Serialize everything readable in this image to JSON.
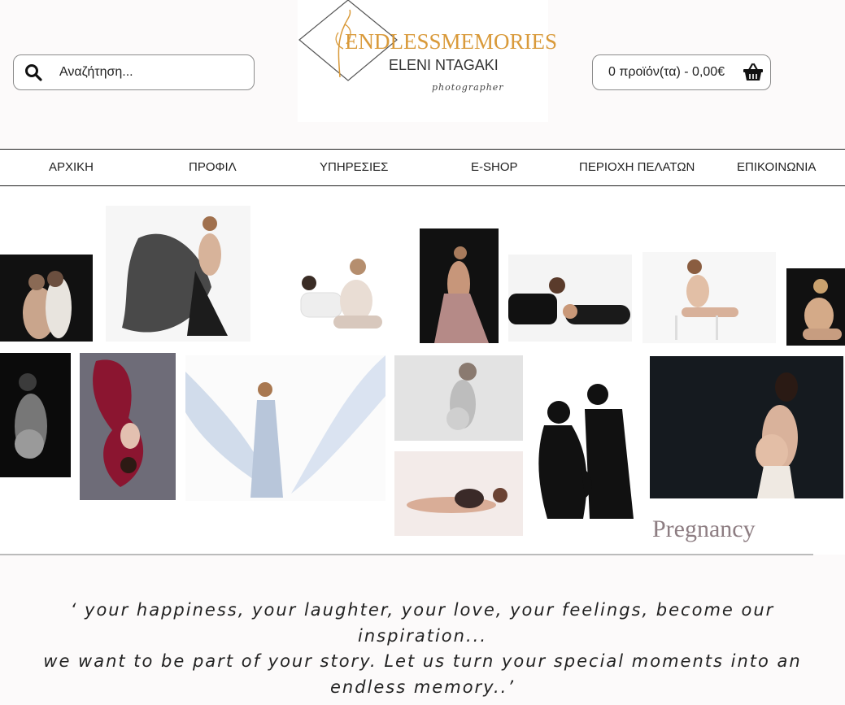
{
  "search": {
    "placeholder": "Αναζήτηση..."
  },
  "logo": {
    "line1": "ENDLESSMEMORIES",
    "line2": "ELENI NTAGAKI",
    "line3": "photographer"
  },
  "cart": {
    "summary": "0 προϊόν(τα) - 0,00€"
  },
  "nav": {
    "items": [
      {
        "label": "ΑΡΧΙΚΗ"
      },
      {
        "label": "ΠΡΟΦΙΛ"
      },
      {
        "label": "ΥΠΗΡΕΣΙΕΣ"
      },
      {
        "label": "E-SHOP"
      },
      {
        "label": "ΠΕΡΙΟΧΗ ΠΕΛΑΤΩΝ"
      },
      {
        "label": "ΕΠΙΚΟΙΝΩΝΙΑ"
      }
    ]
  },
  "collage": {
    "caption": "Pregnancy"
  },
  "quote": {
    "line1": "‘ your happiness, your laughter, your love, your feelings, become our",
    "line2": "inspiration...",
    "line3": "we want to be part of your story. Let us turn your special moments into an",
    "line4": "endless memory..’"
  },
  "colors": {
    "logo_gold": "#d99a3a",
    "nav_border": "#222222",
    "caption": "#8d7d82"
  }
}
